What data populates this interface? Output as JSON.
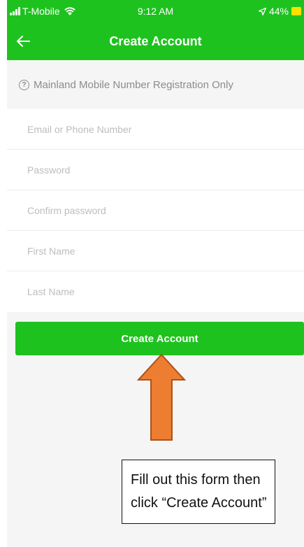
{
  "status_bar": {
    "carrier": "T-Mobile",
    "time": "9:12 AM",
    "battery": "44%"
  },
  "header": {
    "title": "Create Account"
  },
  "notice": {
    "icon": "help-circle-icon",
    "text": "Mainland Mobile Number Registration Only"
  },
  "form": {
    "fields": [
      {
        "placeholder": "Email or Phone Number",
        "value": ""
      },
      {
        "placeholder": "Password",
        "value": ""
      },
      {
        "placeholder": "Confirm password",
        "value": ""
      },
      {
        "placeholder": "First Name",
        "value": ""
      },
      {
        "placeholder": "Last Name",
        "value": ""
      }
    ],
    "submit_label": "Create Account"
  },
  "annotation": {
    "text": "Fill out this form then click “Create Account”",
    "arrow_color": "#ed7d31"
  },
  "colors": {
    "brand_green": "#1ec21e",
    "battery_yellow": "#ffe000"
  }
}
